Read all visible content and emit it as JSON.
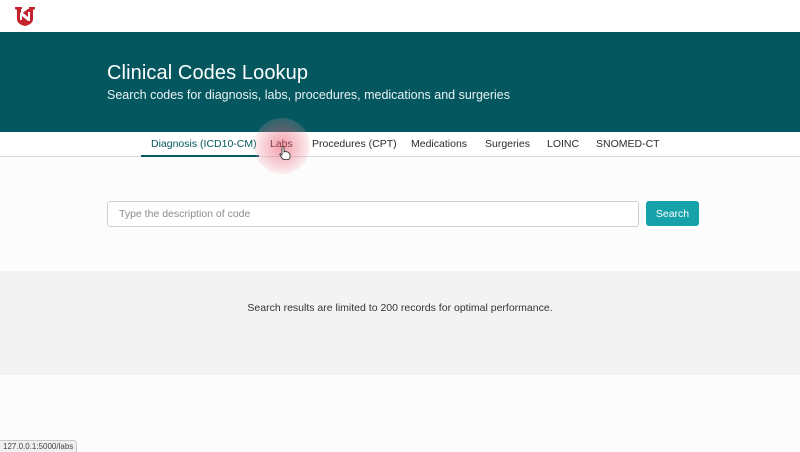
{
  "header": {
    "logo_icon": "nebraska-n-logo-icon",
    "logo_color": "#c4222d"
  },
  "hero": {
    "title": "Clinical Codes Lookup",
    "subtitle": "Search codes for diagnosis, labs, procedures, medications and surgeries",
    "background": "#04575f"
  },
  "tabs": [
    {
      "label": "Diagnosis (ICD10-CM)",
      "active": true
    },
    {
      "label": "Labs",
      "active": false
    },
    {
      "label": "Procedures (CPT)",
      "active": false
    },
    {
      "label": "Medications",
      "active": false
    },
    {
      "label": "Surgeries",
      "active": false
    },
    {
      "label": "LOINC",
      "active": false
    },
    {
      "label": "SNOMED-CT",
      "active": false
    }
  ],
  "search": {
    "placeholder": "Type the description of code",
    "value": "",
    "button_label": "Search",
    "button_color": "#17a2a9"
  },
  "results": {
    "note": "Search results are limited to 200 records for optimal performance."
  },
  "status_bar": {
    "url": "127.0.0.1:5000/labs"
  }
}
